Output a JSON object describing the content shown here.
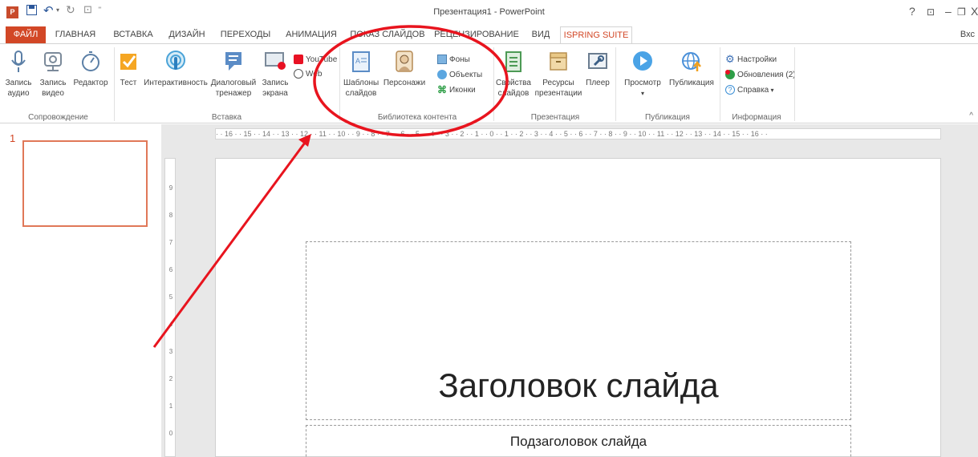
{
  "window": {
    "title": "Презентация1 - PowerPoint",
    "app_icon": "P",
    "controls": [
      "?",
      "⊡",
      "–",
      "🗗",
      "X"
    ]
  },
  "tabs": {
    "file": "ФАЙЛ",
    "items": [
      "ГЛАВНАЯ",
      "ВСТАВКА",
      "ДИЗАЙН",
      "ПЕРЕХОДЫ",
      "АНИМАЦИЯ",
      "ПОКАЗ СЛАЙДОВ",
      "РЕЦЕНЗИРОВАНИЕ",
      "ВИД"
    ],
    "active": "ISPRING SUITE 9",
    "login": "Вхс"
  },
  "ribbon": {
    "groups": {
      "accompaniment": "Сопровождение",
      "insert": "Вставка",
      "library": "Библиотека контента",
      "presentation": "Презентация",
      "publication": "Публикация",
      "info": "Информация"
    },
    "buttons": {
      "record_audio": [
        "Запись",
        "аудио"
      ],
      "record_video": [
        "Запись",
        "видео"
      ],
      "editor": [
        "Редактор",
        ""
      ],
      "test": [
        "Тест"
      ],
      "interactivity": [
        "Интерактивность"
      ],
      "dialog_trainer": [
        "Диалоговый",
        "тренажер"
      ],
      "screen_record": [
        "Запись",
        "экрана"
      ],
      "youtube": "YouTube",
      "web": "Web",
      "templates": [
        "Шаблоны",
        "слайдов"
      ],
      "characters": [
        "Персонажи"
      ],
      "backgrounds": "Фоны",
      "objects": "Объекты",
      "icons": "Иконки",
      "properties": [
        "Свойства",
        "слайдов"
      ],
      "resources": [
        "Ресурсы",
        "презентации"
      ],
      "player": [
        "Плеер"
      ],
      "preview": [
        "Просмотр"
      ],
      "publish": [
        "Публикация"
      ],
      "settings": "Настройки",
      "updates": "Обновления (2)",
      "help": "Справка"
    }
  },
  "ruler": {
    "h": "· · 16 · · 15 · · 14 · · 13 · · 12 · · 11 · · 10 · · 9 · · 8 · · 7 · · 6 · · 5 · · 4 · · 3 · · 2 · · 1 · · 0 · · 1 · · 2 · · 3 · · 4 · · 5 · · 6 · · 7 · · 8 · · 9 · · 10 · · 11 · · 12 · · 13 · · 14 · · 15 · · 16 · ·",
    "v": [
      "9",
      "8",
      "7",
      "6",
      "5",
      "4",
      "3",
      "2",
      "1",
      "0",
      "1"
    ]
  },
  "thumbs": {
    "number": "1"
  },
  "slide": {
    "title": "Заголовок слайда",
    "subtitle": "Подзаголовок слайда"
  },
  "annotation": {
    "ellipse_color": "#e8141e",
    "arrow_color": "#e8141e"
  },
  "colors": {
    "accent": "#d24726"
  }
}
